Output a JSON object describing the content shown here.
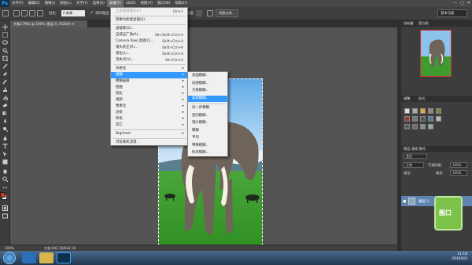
{
  "app": {
    "logo": "Ps"
  },
  "menubar": {
    "items": [
      "文件(F)",
      "编辑(E)",
      "图像(I)",
      "图层(L)",
      "文字(Y)",
      "选择(S)",
      "滤镜(T)",
      "3D(D)",
      "视图(V)",
      "窗口(W)",
      "帮助(H)"
    ],
    "active_index": 6,
    "window_controls": [
      "—",
      "□",
      "✕"
    ]
  },
  "options_bar": {
    "feather_label": "羽化:",
    "feather_value": "0 像素",
    "antialias_label": "消除锯齿",
    "style_label": "样式:",
    "style_value": "正常",
    "width_label": "宽度:",
    "height_label": "高度:",
    "refine_edge": "调整边缘...",
    "workspace": "基本功能"
  },
  "document": {
    "tab_title": "大象2.PNG @ 100% (图层 0, RGB/8) ✕"
  },
  "status_bar": {
    "zoom": "100%",
    "doc_info": "文档:642.1K/642.1K"
  },
  "filter_menu": {
    "items": [
      {
        "label": "上次滤镜操作(F)",
        "shortcut": "Ctrl+F",
        "disabled": true
      },
      {
        "sep": true
      },
      {
        "label": "转换为智能滤镜(S)"
      },
      {
        "sep": true
      },
      {
        "label": "滤镜库(G)..."
      },
      {
        "label": "自适应广角(A)...",
        "shortcut": "Alt+Shift+Ctrl+A"
      },
      {
        "label": "Camera Raw 滤镜(C)...",
        "shortcut": "Shift+Ctrl+A"
      },
      {
        "label": "镜头校正(R)...",
        "shortcut": "Shift+Ctrl+R"
      },
      {
        "label": "液化(L)...",
        "shortcut": "Shift+Ctrl+X"
      },
      {
        "label": "消失点(V)...",
        "shortcut": "Alt+Ctrl+V"
      },
      {
        "sep": true
      },
      {
        "label": "风格化",
        "submenu": true
      },
      {
        "label": "模糊",
        "submenu": true,
        "highlighted": true
      },
      {
        "label": "模糊画廊",
        "submenu": true
      },
      {
        "label": "扭曲",
        "submenu": true
      },
      {
        "label": "锐化",
        "submenu": true
      },
      {
        "label": "视频",
        "submenu": true
      },
      {
        "label": "像素化",
        "submenu": true
      },
      {
        "label": "渲染",
        "submenu": true
      },
      {
        "label": "杂色",
        "submenu": true
      },
      {
        "label": "其它",
        "submenu": true
      },
      {
        "sep": true
      },
      {
        "label": "Digimarc",
        "submenu": true
      },
      {
        "sep": true
      },
      {
        "label": "浏览联机滤镜..."
      }
    ]
  },
  "blur_submenu": {
    "items": [
      {
        "label": "表面模糊..."
      },
      {
        "label": "动感模糊..."
      },
      {
        "label": "方框模糊..."
      },
      {
        "label": "高斯模糊...",
        "highlighted": true
      },
      {
        "label": "进一步模糊"
      },
      {
        "label": "径向模糊..."
      },
      {
        "label": "镜头模糊..."
      },
      {
        "label": "模糊"
      },
      {
        "label": "平均"
      },
      {
        "label": "特殊模糊..."
      },
      {
        "label": "形状模糊..."
      }
    ]
  },
  "panels": {
    "navigator_title": "导航器",
    "histogram_title": "直方图",
    "adjustments_title": "调整",
    "styles_title": "样式",
    "layers_tabs": "图层  通道  路径",
    "layers_kind": "类型",
    "blend_mode": "正常",
    "opacity_label": "不透明度:",
    "opacity_value": "100%",
    "lock_label": "锁定:",
    "fill_label": "填充:",
    "fill_value": "100%",
    "layer_name": "图层 0"
  },
  "badge": {
    "text": "图口"
  },
  "taskbar": {
    "time": "11:18",
    "date": "2016/6/3"
  },
  "colors": {
    "menu_highlight": "#3399ff",
    "layer_selected": "#5f84b0"
  }
}
